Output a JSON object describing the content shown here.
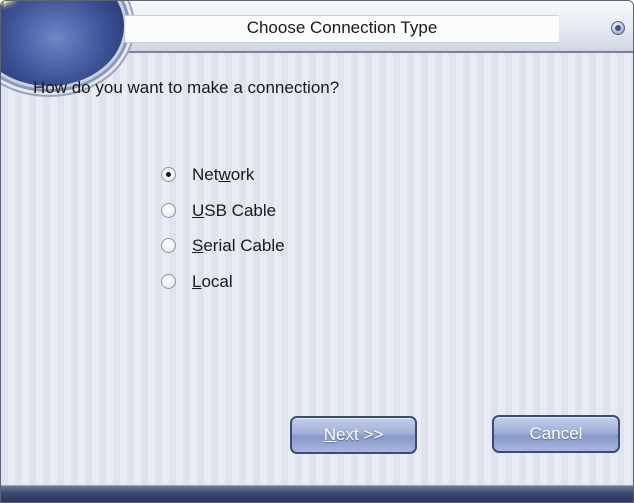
{
  "window": {
    "title": "Choose Connection Type"
  },
  "content": {
    "question": "How do you want to make a connection?",
    "options": [
      {
        "accesskey": "",
        "before": "Net",
        "key": "w",
        "after": "ork",
        "checked": true
      },
      {
        "accesskey": "",
        "before": "",
        "key": "U",
        "after": "SB Cable",
        "checked": false
      },
      {
        "accesskey": "",
        "before": "",
        "key": "S",
        "after": "erial Cable",
        "checked": false
      },
      {
        "accesskey": "",
        "before": "",
        "key": "L",
        "after": "ocal",
        "checked": false
      }
    ]
  },
  "buttons": {
    "next_key": "N",
    "next_rest": "ext >>",
    "cancel_label": "Cancel"
  },
  "colors": {
    "accent": "#3d4a7c",
    "button_fill": "#a1b0d8",
    "background_stripe_a": "#dfe3ee",
    "background_stripe_b": "#e9ecf4"
  },
  "icons": {
    "title_orb": "sun-orb-icon",
    "window_button": "window-menu-icon",
    "radio": "radio-button-icon"
  }
}
